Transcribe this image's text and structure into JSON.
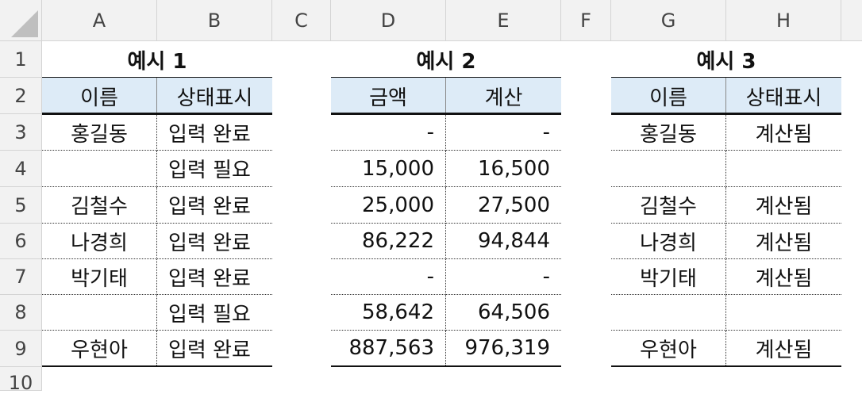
{
  "columns": [
    "A",
    "B",
    "C",
    "D",
    "E",
    "F",
    "G",
    "H"
  ],
  "rows": [
    "1",
    "2",
    "3",
    "4",
    "5",
    "6",
    "7",
    "8",
    "9",
    "10"
  ],
  "example1": {
    "title": "예시 1",
    "headers": [
      "이름",
      "상태표시"
    ],
    "rows": [
      [
        "홍길동",
        "입력 완료"
      ],
      [
        "",
        "입력 필요"
      ],
      [
        "김철수",
        "입력 완료"
      ],
      [
        "나경희",
        "입력 완료"
      ],
      [
        "박기태",
        "입력 완료"
      ],
      [
        "",
        "입력 필요"
      ],
      [
        "우현아",
        "입력 완료"
      ]
    ]
  },
  "example2": {
    "title": "예시 2",
    "headers": [
      "금액",
      "계산"
    ],
    "rows": [
      [
        "-",
        "-"
      ],
      [
        "15,000",
        "16,500"
      ],
      [
        "25,000",
        "27,500"
      ],
      [
        "86,222",
        "94,844"
      ],
      [
        "-",
        "-"
      ],
      [
        "58,642",
        "64,506"
      ],
      [
        "887,563",
        "976,319"
      ]
    ]
  },
  "example3": {
    "title": "예시 3",
    "headers": [
      "이름",
      "상태표시"
    ],
    "rows": [
      [
        "홍길동",
        "계산됨"
      ],
      [
        "",
        ""
      ],
      [
        "김철수",
        "계산됨"
      ],
      [
        "나경희",
        "계산됨"
      ],
      [
        "박기태",
        "계산됨"
      ],
      [
        "",
        ""
      ],
      [
        "우현아",
        "계산됨"
      ]
    ]
  },
  "colors": {
    "header_fill": "#ddebf7",
    "grid_header_bg": "#f2f2f2"
  }
}
